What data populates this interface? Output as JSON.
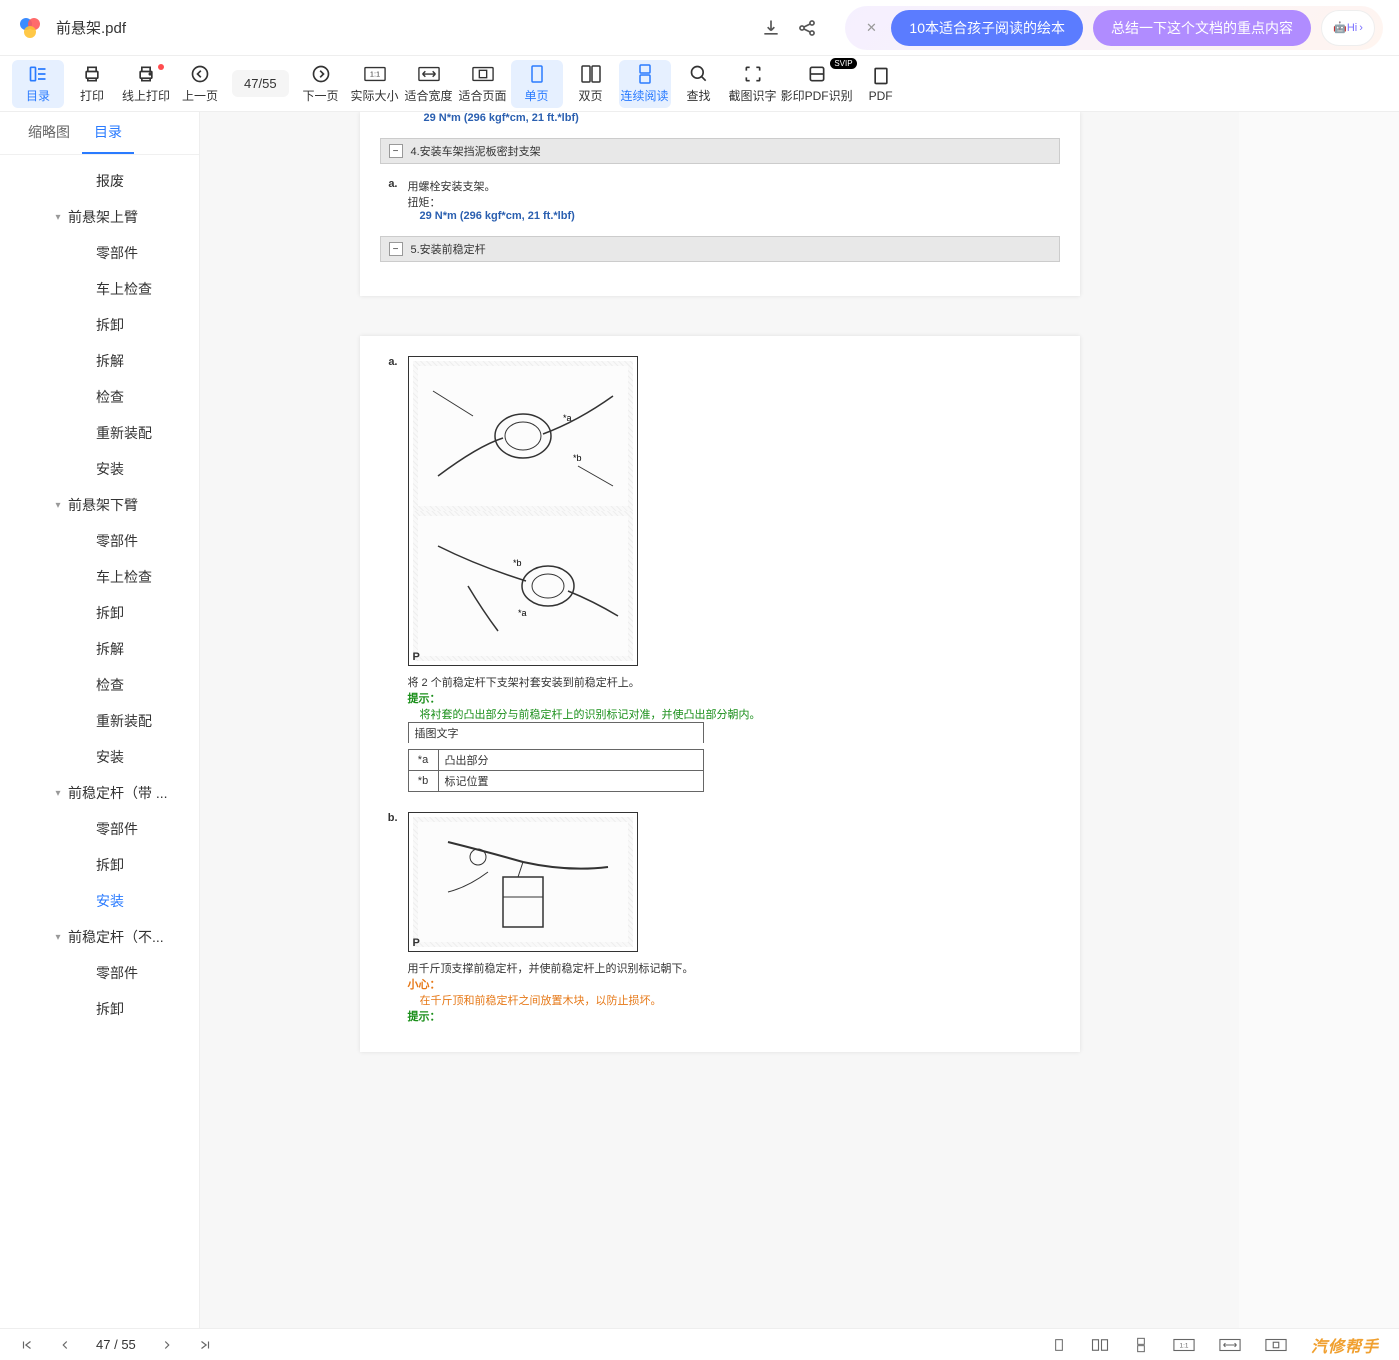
{
  "header": {
    "filename": "前悬架.pdf",
    "ai_chip1": "10本适合孩子阅读的绘本",
    "ai_chip2": "总结一下这个文档的重点内容",
    "ai_hi": "Hi"
  },
  "toolbar": {
    "catalog": "目录",
    "print": "打印",
    "online_print": "线上打印",
    "prev_page": "上一页",
    "page_current": "47",
    "page_sep": " / ",
    "page_total": "55",
    "next_page": "下一页",
    "actual_size": "实际大小",
    "fit_width": "适合宽度",
    "fit_page": "适合页面",
    "single_page": "单页",
    "double_page": "双页",
    "continuous": "连续阅读",
    "search": "查找",
    "screenshot_ocr": "截图识字",
    "scan_pdf": "影印PDF识别",
    "pdf_more": "PDF",
    "svip_badge": "SVIP"
  },
  "sidebar": {
    "tab_thumbnail": "缩略图",
    "tab_catalog": "目录",
    "items": [
      {
        "label": "报废",
        "level": 0
      },
      {
        "label": "前悬架上臂",
        "level": 1,
        "caret": true
      },
      {
        "label": "零部件",
        "level": 2
      },
      {
        "label": "车上检查",
        "level": 2
      },
      {
        "label": "拆卸",
        "level": 2
      },
      {
        "label": "拆解",
        "level": 2
      },
      {
        "label": "检查",
        "level": 2
      },
      {
        "label": "重新装配",
        "level": 2
      },
      {
        "label": "安装",
        "level": 2
      },
      {
        "label": "前悬架下臂",
        "level": 1,
        "caret": true
      },
      {
        "label": "零部件",
        "level": 2
      },
      {
        "label": "车上检查",
        "level": 2
      },
      {
        "label": "拆卸",
        "level": 2
      },
      {
        "label": "拆解",
        "level": 2
      },
      {
        "label": "检查",
        "level": 2
      },
      {
        "label": "重新装配",
        "level": 2
      },
      {
        "label": "安装",
        "level": 2
      },
      {
        "label": "前稳定杆（带 ...",
        "level": 1,
        "caret": true
      },
      {
        "label": "零部件",
        "level": 2
      },
      {
        "label": "拆卸",
        "level": 2
      },
      {
        "label": "安装",
        "level": 2,
        "active": true
      },
      {
        "label": "前稳定杆（不...",
        "level": 1,
        "caret": true
      },
      {
        "label": "零部件",
        "level": 2
      },
      {
        "label": "拆卸",
        "level": 2
      }
    ]
  },
  "doc": {
    "torque1": "29 N*m (296 kgf*cm, 21 ft.*lbf)",
    "section4": "4.安装车架挡泥板密封支架",
    "step_a1_letter": "a.",
    "step_a1": "用螺栓安装支架。",
    "torque_label": "扭矩：",
    "torque2": "29 N*m (296 kgf*cm, 21 ft.*lbf)",
    "section5": "5.安装前稳定杆",
    "step_a2_letter": "a.",
    "diagram_p": "P",
    "step_a2_text": "将 2 个前稳定杆下支架衬套安装到前稳定杆上。",
    "tip_label1": "提示：",
    "tip_text1": "将衬套的凸出部分与前稳定杆上的识别标记对准，并使凸出部分朝内。",
    "legend_header": "插图文字",
    "legend_a_key": "*a",
    "legend_a_val": "凸出部分",
    "legend_b_key": "*b",
    "legend_b_val": "标记位置",
    "step_b_letter": "b.",
    "step_b_text": "用千斤顶支撑前稳定杆，并使前稳定杆上的识别标记朝下。",
    "caution_label": "小心：",
    "caution_text": "在千斤顶和前稳定杆之间放置木块，以防止损坏。",
    "tip_label2": "提示："
  },
  "footer": {
    "page_current": "47",
    "page_sep": " / ",
    "page_total": "55",
    "watermark": "汽修帮手"
  }
}
